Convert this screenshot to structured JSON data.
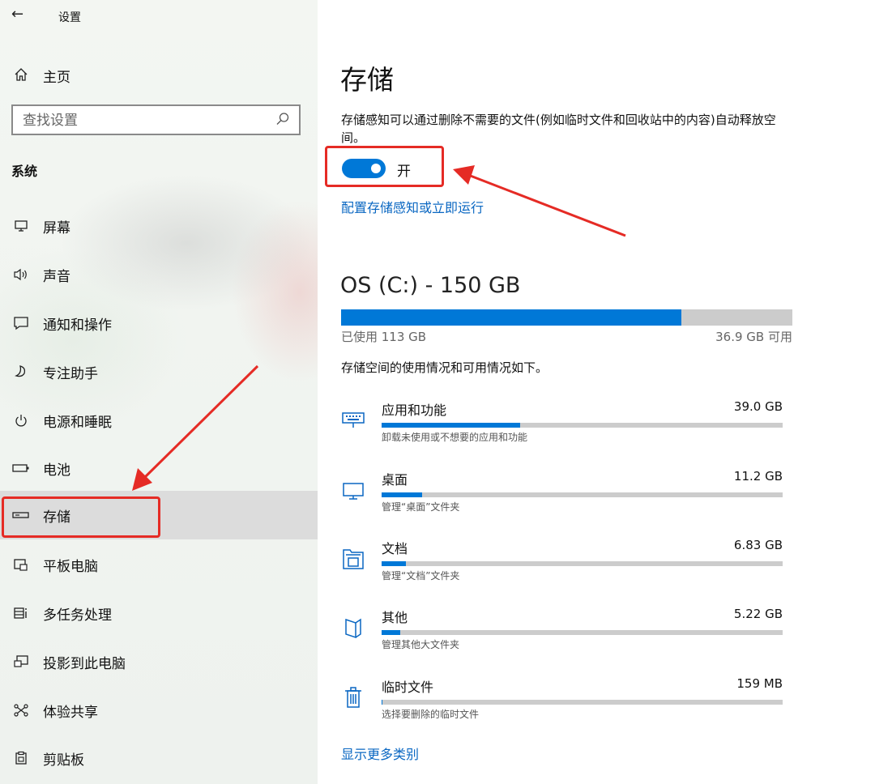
{
  "window": {
    "back_label": "←",
    "title": "设置"
  },
  "sidebar": {
    "home_label": "主页",
    "search_placeholder": "查找设置",
    "section_label": "系统",
    "items": [
      {
        "label": "屏幕",
        "icon": "monitor-icon"
      },
      {
        "label": "声音",
        "icon": "speaker-icon"
      },
      {
        "label": "通知和操作",
        "icon": "notification-icon"
      },
      {
        "label": "专注助手",
        "icon": "moon-icon"
      },
      {
        "label": "电源和睡眠",
        "icon": "power-icon"
      },
      {
        "label": "电池",
        "icon": "battery-icon"
      },
      {
        "label": "存储",
        "icon": "storage-icon",
        "selected": true
      },
      {
        "label": "平板电脑",
        "icon": "tablet-icon"
      },
      {
        "label": "多任务处理",
        "icon": "multitask-icon"
      },
      {
        "label": "投影到此电脑",
        "icon": "project-icon"
      },
      {
        "label": "体验共享",
        "icon": "share-icon"
      },
      {
        "label": "剪贴板",
        "icon": "clipboard-icon"
      }
    ]
  },
  "main": {
    "title": "存储",
    "description": "存储感知可以通过删除不需要的文件(例如临时文件和回收站中的内容)自动释放空间。",
    "toggle": {
      "state": "on",
      "label": "开"
    },
    "config_link": "配置存储感知或立即运行",
    "drive": {
      "title": "OS (C:) - 150 GB",
      "used_label": "已使用 113 GB",
      "free_label": "36.9 GB 可用",
      "used_fraction": 0.754
    },
    "usage_description": "存储空间的使用情况和可用情况如下。",
    "categories": [
      {
        "name": "应用和功能",
        "size": "39.0 GB",
        "sub": "卸载未使用或不想要的应用和功能",
        "fill_fraction": 0.345,
        "icon": "keyboard-icon"
      },
      {
        "name": "桌面",
        "size": "11.2 GB",
        "sub": "管理“桌面”文件夹",
        "fill_fraction": 0.1,
        "icon": "desktop-icon"
      },
      {
        "name": "文档",
        "size": "6.83 GB",
        "sub": "管理“文档”文件夹",
        "fill_fraction": 0.06,
        "icon": "documents-icon"
      },
      {
        "name": "其他",
        "size": "5.22 GB",
        "sub": "管理其他大文件夹",
        "fill_fraction": 0.046,
        "icon": "other-files-icon"
      },
      {
        "name": "临时文件",
        "size": "159 MB",
        "sub": "选择要删除的临时文件",
        "fill_fraction": 0.002,
        "icon": "trash-icon"
      }
    ],
    "more_link": "显示更多类别"
  },
  "colors": {
    "accent": "#0078d7",
    "annotation": "#e52b25",
    "link": "#0a67c2"
  }
}
